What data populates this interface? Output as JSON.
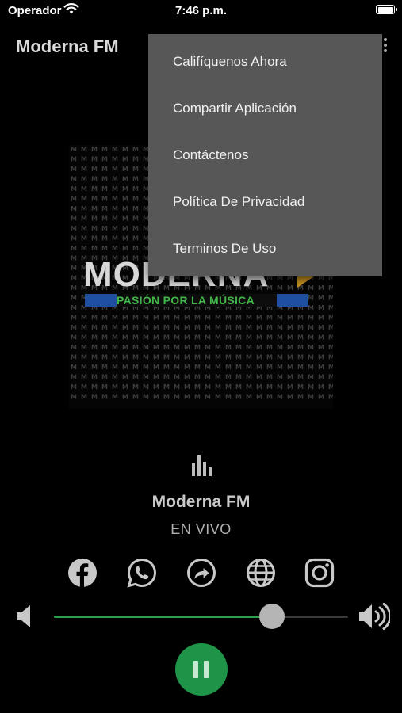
{
  "status_bar": {
    "carrier": "Operador",
    "time": "7:46 p.m.",
    "wifi_icon": "wifi-icon",
    "battery_icon": "battery-icon"
  },
  "app": {
    "title": "Moderna FM",
    "menu_icon": "more-vert-icon"
  },
  "menu": {
    "items": [
      {
        "label": "Califíquenos Ahora"
      },
      {
        "label": "Compartir Aplicación"
      },
      {
        "label": "Contáctenos"
      },
      {
        "label": "Política De Privacidad"
      },
      {
        "label": "Terminos De Uso"
      }
    ]
  },
  "artwork": {
    "logo_text": "MODERNA",
    "tagline": "PASIÓN POR LA MÚSICA",
    "pattern_text": "M"
  },
  "player": {
    "station_name": "Moderna FM",
    "status": "EN VIVO",
    "volume_fraction": 0.74,
    "social_icons": [
      "facebook-icon",
      "whatsapp-icon",
      "share-icon",
      "globe-icon",
      "instagram-icon"
    ]
  },
  "colors": {
    "accent": "#1f9448",
    "menu_bg": "#575757",
    "background": "#000000"
  }
}
